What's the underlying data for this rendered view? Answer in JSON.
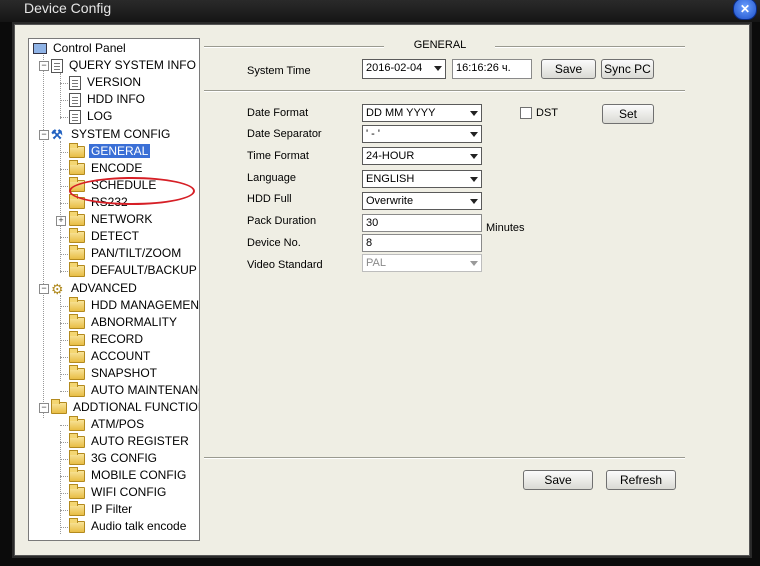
{
  "window": {
    "title": "Device Config",
    "close_icon": "close-icon"
  },
  "tree": {
    "root": "Control Panel",
    "query": {
      "label": "QUERY SYSTEM INFO",
      "items": [
        "VERSION",
        "HDD INFO",
        "LOG"
      ]
    },
    "system": {
      "label": "SYSTEM CONFIG",
      "items": [
        "GENERAL",
        "ENCODE",
        "SCHEDULE",
        "RS232",
        "NETWORK",
        "DETECT",
        "PAN/TILT/ZOOM",
        "DEFAULT/BACKUP"
      ]
    },
    "advanced": {
      "label": "ADVANCED",
      "items": [
        "HDD MANAGEMENT",
        "ABNORMALITY",
        "RECORD",
        "ACCOUNT",
        "SNAPSHOT",
        "AUTO MAINTENANC"
      ]
    },
    "additional": {
      "label": "ADDTIONAL FUNCTION",
      "items": [
        "ATM/POS",
        "AUTO REGISTER",
        "3G CONFIG",
        "MOBILE CONFIG",
        "WIFI CONFIG",
        "IP Filter",
        "Audio talk encode"
      ]
    },
    "selected": "GENERAL"
  },
  "general": {
    "title": "GENERAL",
    "system_time": {
      "label": "System Time",
      "date": "2016-02-04",
      "time": "16:16:26 ч.",
      "save": "Save",
      "sync": "Sync PC"
    },
    "date_format": {
      "label": "Date Format",
      "value": "DD MM YYYY"
    },
    "dst": {
      "label": "DST",
      "set": "Set"
    },
    "date_separator": {
      "label": "Date Separator",
      "value": "' - '"
    },
    "time_format": {
      "label": "Time Format",
      "value": "24-HOUR"
    },
    "language": {
      "label": "Language",
      "value": "ENGLISH"
    },
    "hdd_full": {
      "label": "HDD Full",
      "value": "Overwrite"
    },
    "pack_duration": {
      "label": "Pack Duration",
      "value": "30",
      "unit": "Minutes"
    },
    "device_no": {
      "label": "Device No.",
      "value": "8"
    },
    "video_standard": {
      "label": "Video Standard",
      "value": "PAL"
    },
    "footer": {
      "save": "Save",
      "refresh": "Refresh"
    }
  }
}
